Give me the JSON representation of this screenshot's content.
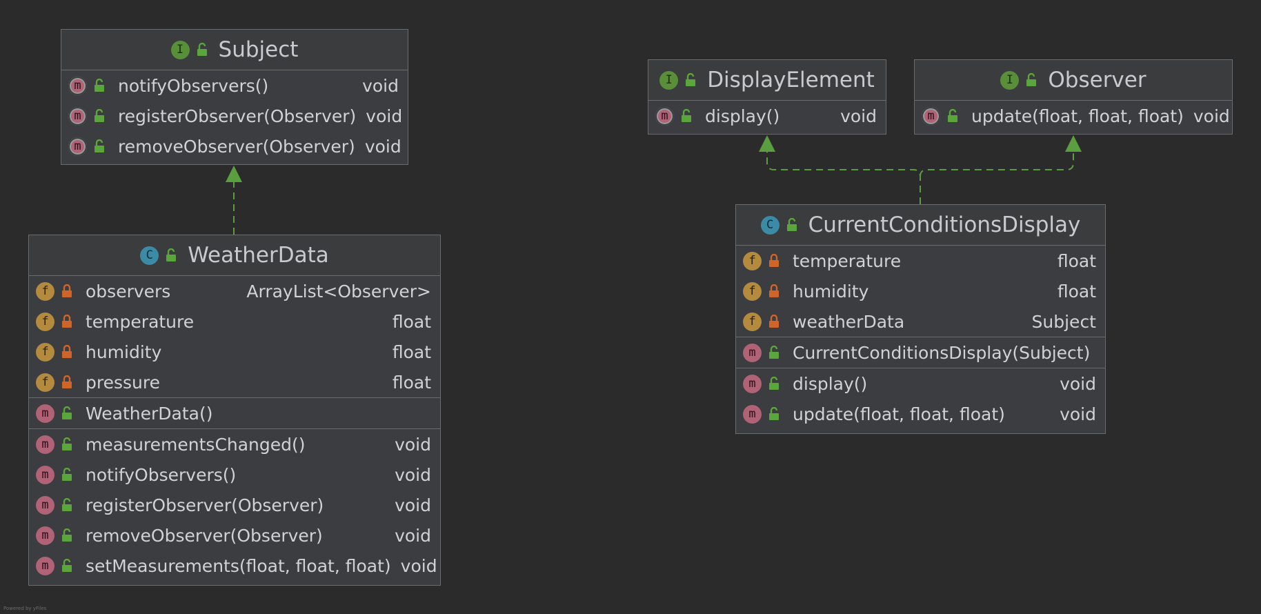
{
  "colors": {
    "background": "#2b2b2b",
    "box_fill": "#3b3d40",
    "border": "#6a6c6e",
    "arrow": "#5a9e3f",
    "interface_badge": "#5a8f3a",
    "class_badge": "#3b8aa6",
    "field_badge": "#b48a3f",
    "method_badge": "#b06277",
    "private_lock": "#d0652a",
    "public_lock": "#5aa53c"
  },
  "boxes": {
    "subject": {
      "kind_letter": "I",
      "title": "Subject",
      "methods": [
        {
          "name": "notifyObservers()",
          "type": "void"
        },
        {
          "name": "registerObserver(Observer)",
          "type": "void"
        },
        {
          "name": "removeObserver(Observer)",
          "type": "void"
        }
      ]
    },
    "weather_data": {
      "kind_letter": "C",
      "title": "WeatherData",
      "fields": [
        {
          "name": "observers",
          "type": "ArrayList<Observer>"
        },
        {
          "name": "temperature",
          "type": "float"
        },
        {
          "name": "humidity",
          "type": "float"
        },
        {
          "name": "pressure",
          "type": "float"
        }
      ],
      "constructors": [
        {
          "name": "WeatherData()",
          "type": ""
        }
      ],
      "methods": [
        {
          "name": "measurementsChanged()",
          "type": "void"
        },
        {
          "name": "notifyObservers()",
          "type": "void"
        },
        {
          "name": "registerObserver(Observer)",
          "type": "void"
        },
        {
          "name": "removeObserver(Observer)",
          "type": "void"
        },
        {
          "name": "setMeasurements(float, float, float)",
          "type": "void"
        }
      ]
    },
    "display_element": {
      "kind_letter": "I",
      "title": "DisplayElement",
      "methods": [
        {
          "name": "display()",
          "type": "void"
        }
      ]
    },
    "observer": {
      "kind_letter": "I",
      "title": "Observer",
      "methods": [
        {
          "name": "update(float, float, float)",
          "type": "void"
        }
      ]
    },
    "current_conditions": {
      "kind_letter": "C",
      "title": "CurrentConditionsDisplay",
      "fields": [
        {
          "name": "temperature",
          "type": "float"
        },
        {
          "name": "humidity",
          "type": "float"
        },
        {
          "name": "weatherData",
          "type": "Subject"
        }
      ],
      "constructors": [
        {
          "name": "CurrentConditionsDisplay(Subject)",
          "type": ""
        }
      ],
      "methods": [
        {
          "name": "display()",
          "type": "void"
        },
        {
          "name": "update(float, float, float)",
          "type": "void"
        }
      ]
    }
  },
  "badge_letters": {
    "field": "f",
    "method": "m"
  },
  "footer": "Powered by yFiles"
}
